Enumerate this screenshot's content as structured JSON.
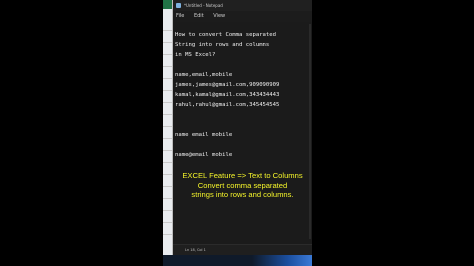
{
  "window": {
    "title": "*Untitled - Notepad"
  },
  "menu": {
    "items": [
      "File",
      "Edit",
      "View"
    ]
  },
  "editor": {
    "lines": [
      "How to convert Comma separated",
      "String into rows and columns",
      "in MS Excel?",
      "",
      "name,email,mobile",
      "james,james@gmail.com,909090909",
      "kamal,kamal@gmail.com,343434443",
      "rahul,rahul@gmail.com,345454545",
      "",
      "",
      "",
      "name email mobile",
      "",
      "name@email mobile"
    ]
  },
  "overlay": {
    "line1": "EXCEL Feature => Text to Columns",
    "line2": "Convert comma separated",
    "line3": "strings into rows and columns."
  },
  "statusbar": {
    "position": "Ln 18, Col 1"
  },
  "colors": {
    "overlay_text": "#f5f52a",
    "editor_bg": "#1b1b1b",
    "excel_green": "#217346"
  }
}
